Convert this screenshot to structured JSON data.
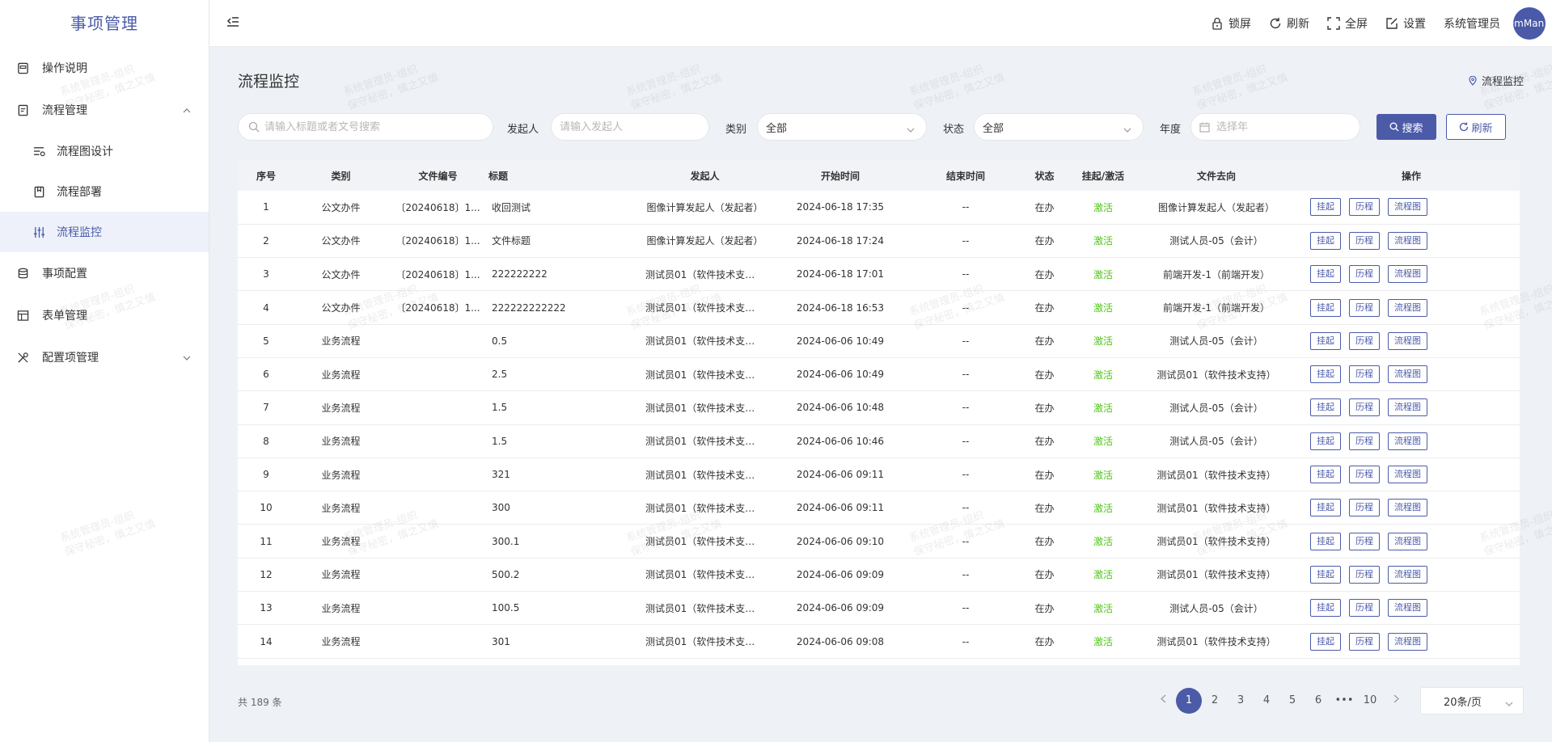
{
  "app": {
    "title": "事项管理"
  },
  "sidebar": {
    "items": [
      {
        "label": "操作说明",
        "icon": "book-icon"
      },
      {
        "label": "流程管理",
        "icon": "document-icon",
        "expanded": true,
        "children": [
          {
            "label": "流程图设计",
            "icon": "flow-design-icon"
          },
          {
            "label": "流程部署",
            "icon": "deploy-icon"
          },
          {
            "label": "流程监控",
            "icon": "sliders-icon",
            "active": true
          }
        ]
      },
      {
        "label": "事项配置",
        "icon": "database-icon"
      },
      {
        "label": "表单管理",
        "icon": "table-icon"
      },
      {
        "label": "配置项管理",
        "icon": "tools-icon"
      }
    ]
  },
  "header": {
    "lock": "锁屏",
    "refresh": "刷新",
    "fullscreen": "全屏",
    "settings": "设置",
    "user": "系统管理员",
    "avatar_text": "emMan"
  },
  "page": {
    "title": "流程监控",
    "breadcrumb": "流程监控"
  },
  "filters": {
    "search_placeholder": "请输入标题或者文号搜索",
    "initiator_label": "发起人",
    "initiator_placeholder": "请输入发起人",
    "category_label": "类别",
    "category_value": "全部",
    "status_label": "状态",
    "status_value": "全部",
    "year_label": "年度",
    "year_placeholder": "选择年",
    "search_button": "搜索",
    "refresh_button": "刷新"
  },
  "table": {
    "columns": [
      "序号",
      "类别",
      "文件编号",
      "标题",
      "发起人",
      "开始时间",
      "结束时间",
      "状态",
      "挂起/激活",
      "文件去向",
      "操作"
    ],
    "op_labels": [
      "挂起",
      "历程",
      "流程图"
    ],
    "rows": [
      [
        "1",
        "公文办件",
        "〔20240618〕1...",
        "收回测试",
        "图像计算发起人（发起者）",
        "2024-06-18 17:35",
        "--",
        "在办",
        "激活",
        "图像计算发起人（发起者）"
      ],
      [
        "2",
        "公文办件",
        "〔20240618〕1...",
        "文件标题",
        "图像计算发起人（发起者）",
        "2024-06-18 17:24",
        "--",
        "在办",
        "激活",
        "测试人员-05（会计）"
      ],
      [
        "3",
        "公文办件",
        "〔20240618〕1...",
        "222222222",
        "测试员01（软件技术支持）",
        "2024-06-18 17:01",
        "--",
        "在办",
        "激活",
        "前端开发-1（前端开发）"
      ],
      [
        "4",
        "公文办件",
        "〔20240618〕1...",
        "222222222222",
        "测试员01（软件技术支持）",
        "2024-06-18 16:53",
        "--",
        "在办",
        "激活",
        "前端开发-1（前端开发）"
      ],
      [
        "5",
        "业务流程",
        "",
        "0.5",
        "测试员01（软件技术支持）",
        "2024-06-06 10:49",
        "--",
        "在办",
        "激活",
        "测试人员-05（会计）"
      ],
      [
        "6",
        "业务流程",
        "",
        "2.5",
        "测试员01（软件技术支持）",
        "2024-06-06 10:49",
        "--",
        "在办",
        "激活",
        "测试员01（软件技术支持）"
      ],
      [
        "7",
        "业务流程",
        "",
        "1.5",
        "测试员01（软件技术支持）",
        "2024-06-06 10:48",
        "--",
        "在办",
        "激活",
        "测试人员-05（会计）"
      ],
      [
        "8",
        "业务流程",
        "",
        "1.5",
        "测试员01（软件技术支持）",
        "2024-06-06 10:46",
        "--",
        "在办",
        "激活",
        "测试人员-05（会计）"
      ],
      [
        "9",
        "业务流程",
        "",
        "321",
        "测试员01（软件技术支持）",
        "2024-06-06 09:11",
        "--",
        "在办",
        "激活",
        "测试员01（软件技术支持）"
      ],
      [
        "10",
        "业务流程",
        "",
        "300",
        "测试员01（软件技术支持）",
        "2024-06-06 09:11",
        "--",
        "在办",
        "激活",
        "测试员01（软件技术支持）"
      ],
      [
        "11",
        "业务流程",
        "",
        "300.1",
        "测试员01（软件技术支持）",
        "2024-06-06 09:10",
        "--",
        "在办",
        "激活",
        "测试员01（软件技术支持）"
      ],
      [
        "12",
        "业务流程",
        "",
        "500.2",
        "测试员01（软件技术支持）",
        "2024-06-06 09:09",
        "--",
        "在办",
        "激活",
        "测试员01（软件技术支持）"
      ],
      [
        "13",
        "业务流程",
        "",
        "100.5",
        "测试员01（软件技术支持）",
        "2024-06-06 09:09",
        "--",
        "在办",
        "激活",
        "测试人员-05（会计）"
      ],
      [
        "14",
        "业务流程",
        "",
        "301",
        "测试员01（软件技术支持）",
        "2024-06-06 09:08",
        "--",
        "在办",
        "激活",
        "测试员01（软件技术支持）"
      ]
    ]
  },
  "pagination": {
    "total": "共 189 条",
    "pages": [
      "1",
      "2",
      "3",
      "4",
      "5",
      "6",
      "•••",
      "10"
    ],
    "current": "1",
    "page_size": "20条/页"
  },
  "watermark": {
    "line1": "系统管理员-组织",
    "line2": "保守秘密，慎之又慎"
  },
  "colors": {
    "primary": "#4b5ba8",
    "success": "#52c41a",
    "background": "#eef1f6"
  }
}
